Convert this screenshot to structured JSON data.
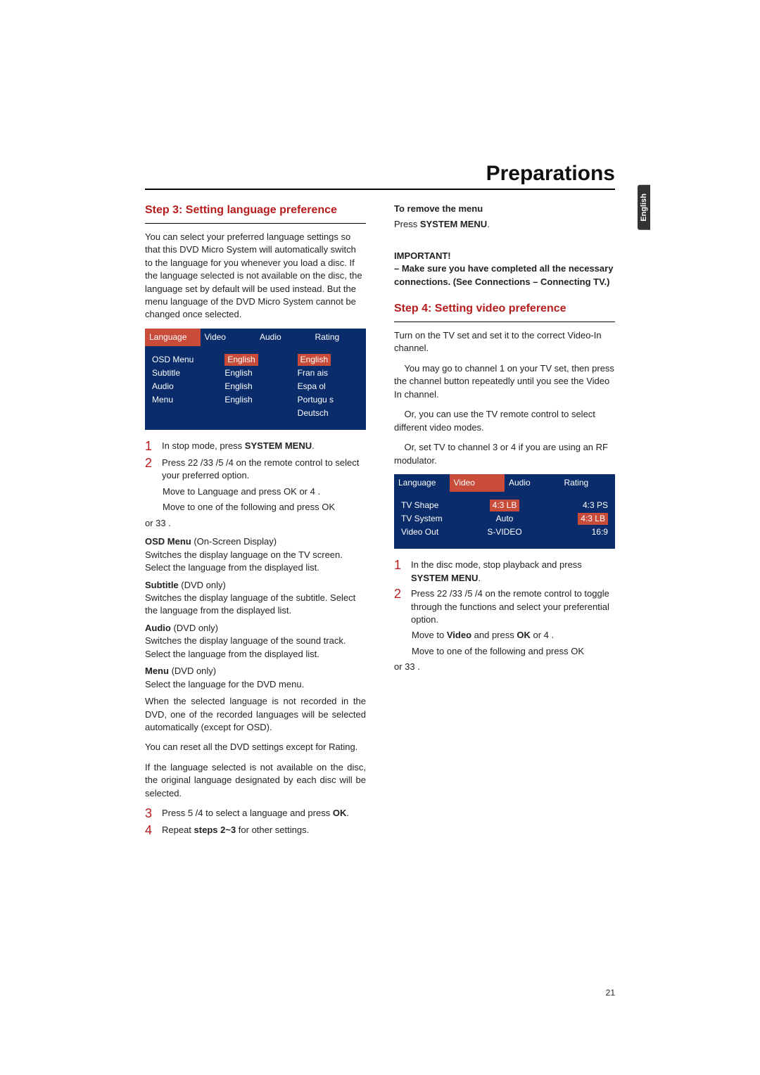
{
  "page": {
    "title": "Preparations",
    "language_tab": "English",
    "number": "21"
  },
  "left": {
    "step_title": "Step 3:   Setting language preference",
    "intro": "You can select your preferred language settings so that this DVD Micro System will automatically switch to the language for you whenever you load a disc. If the language selected is not available on the disc, the language set by default will be used instead. But the menu language of the DVD Micro System cannot be changed once selected.",
    "osd": {
      "tabs": [
        "Language",
        "Video",
        "Audio",
        "Rating"
      ],
      "active_tab": 0,
      "labels": [
        "OSD Menu",
        "Subtitle",
        "Audio",
        "Menu"
      ],
      "values": [
        "English",
        "English",
        "English",
        "English"
      ],
      "extra": [
        "English",
        "Fran ais",
        "Espa ol",
        "Portugu s",
        "Deutsch"
      ]
    },
    "steps": {
      "s1": "In stop mode, press ",
      "s1b": "SYSTEM MENU",
      "s2": "Press 22  /33  /5 /4  on the remote control to select your preferred option.",
      "bullet1_a": "Move to ",
      "bullet1_b": "Language",
      "bullet1_c": " and press ",
      "bullet1_d": "OK",
      "bullet1_e": " or 4 .",
      "bullet2_a": "Move to one of the following and press ",
      "bullet2_b": "OK",
      "bullet2_c": " or 33  .",
      "def_osd_t": "OSD Menu",
      "def_osd_n": " (On-Screen Display)",
      "def_osd_b": "Switches the display language on the TV screen. Select the language from the displayed list.",
      "def_sub_t": "Subtitle",
      "def_sub_n": " (DVD only)",
      "def_sub_b": "Switches the display language of the subtitle. Select the language from the displayed list.",
      "def_aud_t": "Audio",
      "def_aud_n": " (DVD only)",
      "def_aud_b": "Switches the display language of the sound track. Select the language from the displayed list.",
      "def_menu_t": "Menu",
      "def_menu_n": " (DVD only)",
      "def_menu_b": "Select the language for the DVD menu.",
      "note1": " When the selected language is not recorded in the DVD, one of the recorded languages will be selected automatically (except for OSD).",
      "note2": "You can reset all the DVD settings except for Rating.",
      "note3": "If the language selected is not available on the disc, the original language designated by each disc will be selected.",
      "s3a": "Press 5 /4  to select a language and press ",
      "s3b": "OK",
      "s4a": "Repeat ",
      "s4b": "steps 2~3",
      "s4c": " for other settings."
    }
  },
  "right": {
    "remove_t": "To remove the menu",
    "remove_a": "Press ",
    "remove_b": "SYSTEM MENU",
    "important_t": "IMPORTANT!",
    "important_b": "–  Make sure you have completed all the necessary connections. (See Connections – Connecting TV.)",
    "step_title": "Step 4:   Setting video preference",
    "p1": "Turn on the TV set and set it to the correct Video-In channel.",
    "p2": "You may go to channel 1 on your TV set, then press the channel button repeatedly until you see the Video In channel.",
    "p3": "Or, you can use the TV remote control to select different video modes.",
    "p4": "Or, set TV to channel 3 or 4 if you are using an RF modulator.",
    "osd": {
      "tabs": [
        "Language",
        "Video",
        "Audio",
        "Rating"
      ],
      "active_tab": 1,
      "labels": [
        "TV Shape",
        "TV System",
        "Video Out"
      ],
      "values": [
        "4:3 LB",
        "Auto",
        "S-VIDEO"
      ],
      "extra": [
        "4:3 PS",
        "4:3 LB",
        "16:9"
      ]
    },
    "steps": {
      "s1a": "In the disc mode, stop playback and press ",
      "s1b": "SYSTEM MENU",
      "s2": "Press 22  /33  /5 /4  on the remote control to toggle through the functions and select your preferential option.",
      "bullet1_a": "Move to ",
      "bullet1_b": "Video",
      "bullet1_c": " and press ",
      "bullet1_d": "OK",
      "bullet1_e": " or 4 .",
      "bullet2_a": "Move to one of the following and press ",
      "bullet2_b": "OK",
      "bullet2_c": " or 33  ."
    }
  }
}
